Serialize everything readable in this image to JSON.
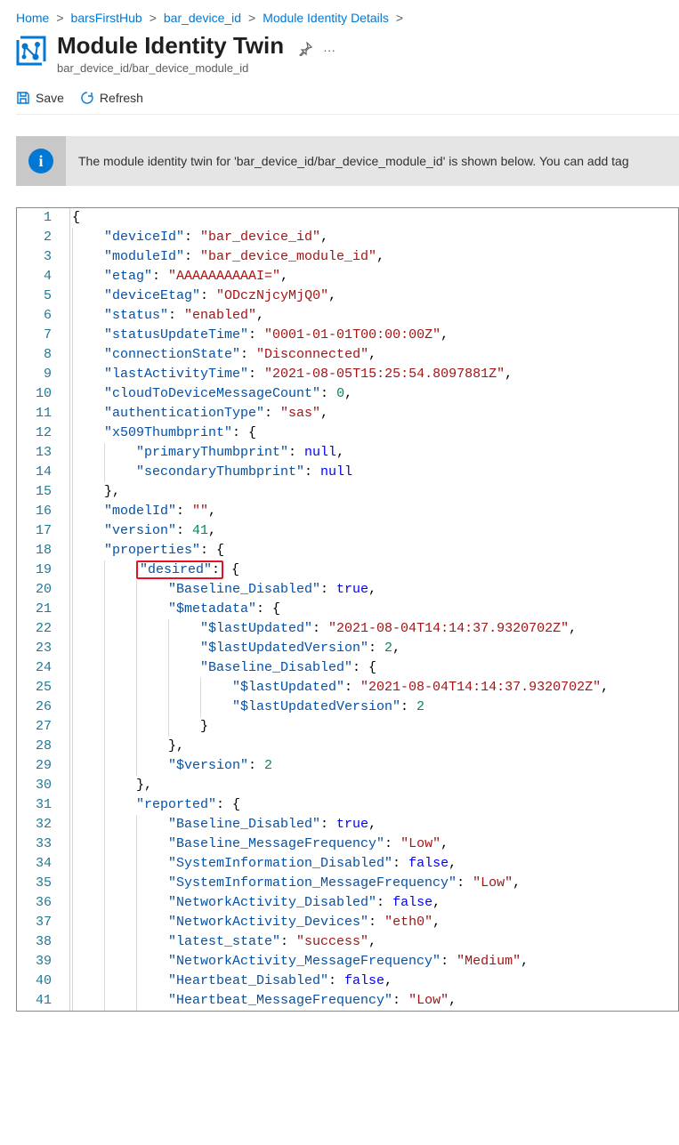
{
  "breadcrumb": {
    "items": [
      "Home",
      "barsFirstHub",
      "bar_device_id",
      "Module Identity Details"
    ]
  },
  "header": {
    "title": "Module Identity Twin",
    "subtitle": "bar_device_id/bar_device_module_id"
  },
  "toolbar": {
    "save": "Save",
    "refresh": "Refresh"
  },
  "info": {
    "text": "The module identity twin for 'bar_device_id/bar_device_module_id' is shown below. You can add tag"
  },
  "json": {
    "deviceId": "bar_device_id",
    "moduleId": "bar_device_module_id",
    "etag": "AAAAAAAAAAI=",
    "deviceEtag": "ODczNjcyMjQ0",
    "status": "enabled",
    "statusUpdateTime": "0001-01-01T00:00:00Z",
    "connectionState": "Disconnected",
    "lastActivityTime": "2021-08-05T15:25:54.8097881Z",
    "cloudToDeviceMessageCount": "0",
    "authenticationType": "sas",
    "x509": {
      "primaryThumbprint": "null",
      "secondaryThumbprint": "null"
    },
    "modelId": "",
    "version": "41",
    "desired": {
      "Baseline_Disabled": "true",
      "meta_lastUpdated": "2021-08-04T14:14:37.9320702Z",
      "meta_lastUpdatedVersion": "2",
      "bd_lastUpdated": "2021-08-04T14:14:37.9320702Z",
      "bd_lastUpdatedVersion": "2",
      "version": "2"
    },
    "reported": {
      "Baseline_Disabled": "true",
      "Baseline_MessageFrequency": "Low",
      "SystemInformation_Disabled": "false",
      "SystemInformation_MessageFrequency": "Low",
      "NetworkActivity_Disabled": "false",
      "NetworkActivity_Devices": "eth0",
      "latest_state": "success",
      "NetworkActivity_MessageFrequency": "Medium",
      "Heartbeat_Disabled": "false",
      "Heartbeat_MessageFrequency": "Low"
    }
  },
  "lineCount": 41
}
